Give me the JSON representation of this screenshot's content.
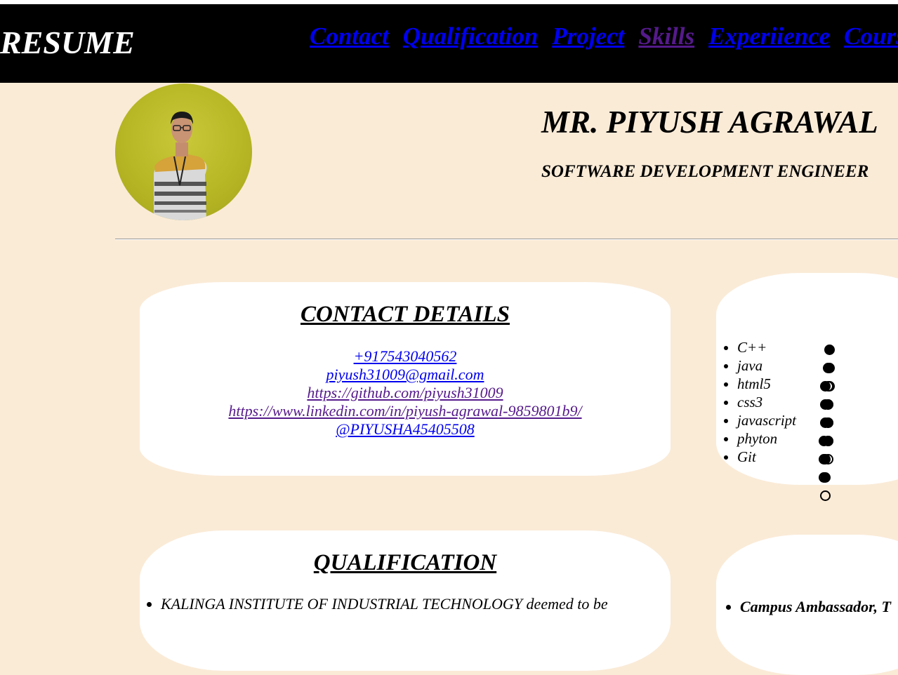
{
  "header": {
    "brand": "RESUME",
    "nav": [
      {
        "label": "Contact",
        "visited": false
      },
      {
        "label": "Qualification",
        "visited": false
      },
      {
        "label": "Project",
        "visited": false
      },
      {
        "label": "Skills",
        "visited": true
      },
      {
        "label": "Experiience",
        "visited": false
      },
      {
        "label": "Courses",
        "visited": false
      }
    ]
  },
  "profile": {
    "name": "MR. PIYUSH AGRAWAL",
    "role": "SOFTWARE DEVELOPMENT ENGINEER"
  },
  "contact": {
    "title": "CONTACT DETAILS",
    "phone": "+917543040562",
    "email": "piyush31009@gmail.com",
    "github": "https://github.com/piyush31009",
    "linkedin": "https://www.linkedin.com/in/piyush-agrawal-9859801b9/",
    "twitter": "@PIYUSHA45405508"
  },
  "skills": {
    "items": [
      {
        "name": "C++",
        "level": 2,
        "max": 3
      },
      {
        "name": "java",
        "level": 1,
        "max": 3
      },
      {
        "name": "html5",
        "level": 3,
        "max": 3
      },
      {
        "name": "css3",
        "level": 3,
        "max": 3
      },
      {
        "name": "javascript",
        "level": 1,
        "max": 3
      },
      {
        "name": "phyton",
        "level": 1,
        "max": 3
      },
      {
        "name": "Git",
        "level": 2,
        "max": 3
      }
    ]
  },
  "qualification": {
    "title": "QUALIFICATION",
    "items": [
      "KALINGA INSTITUTE OF INDUSTRIAL TECHNOLOGY deemed to be"
    ]
  },
  "experience": {
    "items": [
      "Campus Ambassador, T"
    ]
  },
  "colors": {
    "page_bg": "#faebd7",
    "nav_bg": "#000000",
    "link": "#0000ee",
    "visited_link": "#551a8b"
  }
}
